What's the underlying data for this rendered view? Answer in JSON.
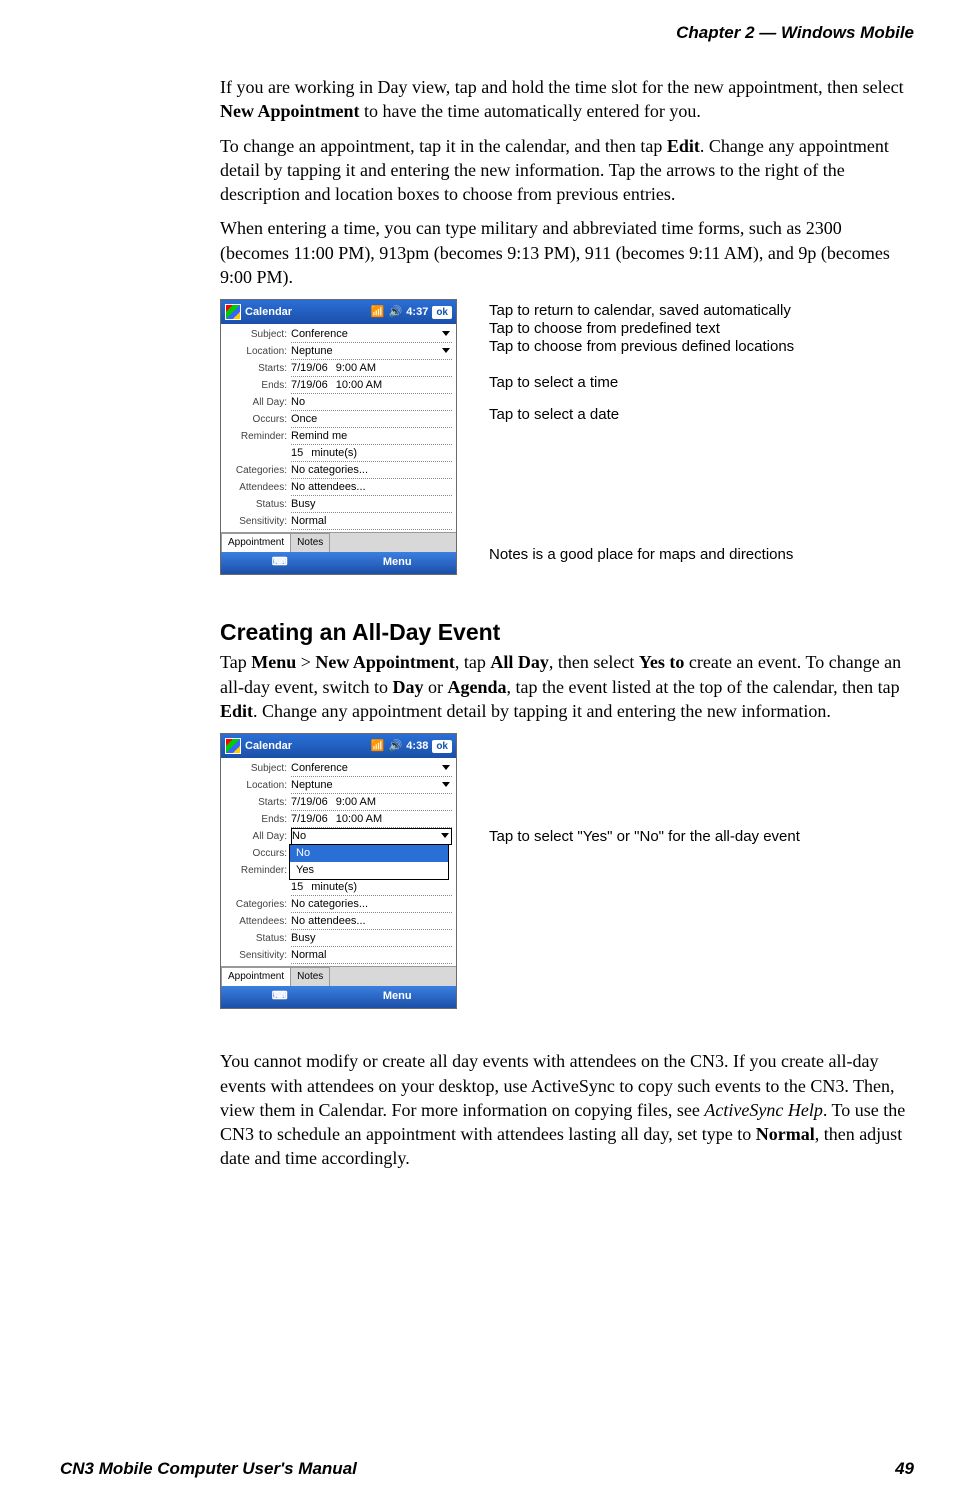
{
  "header": {
    "chapter": "Chapter 2 —  Windows Mobile"
  },
  "para1": {
    "a": "If you are working in Day view, tap and hold the time slot for the new appointment, then select ",
    "b": "New Appointment",
    "c": " to have the time automatically entered for you."
  },
  "para2": {
    "a": "To change an appointment, tap it in the calendar, and then tap ",
    "b": "Edit",
    "c": ". Change any appointment detail by tapping it and entering the new information. Tap the arrows to the right of the description and location boxes to choose from previous entries."
  },
  "para3": {
    "text": "When entering a time, you can type military and abbreviated time forms, such as 2300 (becomes 11:00 PM), 913pm (becomes 9:13 PM), 911 (becomes 9:11 AM), and 9p (becomes 9:00 PM)."
  },
  "fig1": {
    "callouts": {
      "c1": "Tap to return to calendar, saved automatically",
      "c2": "Tap to choose from predefined text",
      "c3": "Tap to choose from previous defined locations",
      "c4": "Tap to select a time",
      "c5": "Tap to select a date",
      "c6": "Notes is a good place for maps and directions"
    },
    "title": "Calendar",
    "time": "4:37",
    "ok": "ok",
    "labels": {
      "subject": "Subject:",
      "location": "Location:",
      "starts": "Starts:",
      "ends": "Ends:",
      "allday": "All Day:",
      "occurs": "Occurs:",
      "reminder": "Reminder:",
      "categories": "Categories:",
      "attendees": "Attendees:",
      "status": "Status:",
      "sensitivity": "Sensitivity:"
    },
    "values": {
      "subject": "Conference",
      "location": "Neptune",
      "start_date": "7/19/06",
      "start_time": "9:00 AM",
      "end_date": "7/19/06",
      "end_time": "10:00 AM",
      "allday": "No",
      "occurs": "Once",
      "reminder1": "Remind me",
      "reminder2a": "15",
      "reminder2b": "minute(s)",
      "categories": "No categories...",
      "attendees": "No attendees...",
      "status": "Busy",
      "sensitivity": "Normal"
    },
    "tabs": {
      "t1": "Appointment",
      "t2": "Notes"
    },
    "menu": "Menu"
  },
  "section2": {
    "heading": "Creating an All-Day Event",
    "p1": {
      "a": "Tap ",
      "b": "Menu",
      "c": " > ",
      "d": "New Appointment",
      "e": ", tap ",
      "f": "All Day",
      "g": ", then select ",
      "h": "Yes to",
      "i": " create an event. To change an all-day event, switch to ",
      "j": "Day",
      "k": " or ",
      "l": "Agenda",
      "m": ", tap the event listed at the top of the calendar, then tap ",
      "n": "Edit",
      "o": ". Change any appointment detail by tapping it and entering the new information."
    }
  },
  "fig2": {
    "callout": "Tap to select \"Yes\" or \"No\" for the all-day event",
    "title": "Calendar",
    "time": "4:38",
    "ok": "ok",
    "values": {
      "subject": "Conference",
      "location": "Neptune",
      "start_date": "7/19/06",
      "start_time": "9:00 AM",
      "end_date": "7/19/06",
      "end_time": "10:00 AM",
      "allday": "No",
      "opt1": "No",
      "opt2": "Yes",
      "reminder2a": "15",
      "reminder2b": "minute(s)",
      "categories": "No categories...",
      "attendees": "No attendees...",
      "status": "Busy",
      "sensitivity": "Normal"
    },
    "tabs": {
      "t1": "Appointment",
      "t2": "Notes"
    },
    "menu": "Menu"
  },
  "para_after": {
    "a": "You cannot modify or create all day events with attendees on the CN3. If you create all-day events with attendees on your desktop, use ActiveSync to copy such events to the CN3. Then, view them in Calendar. For more information on copying files, see ",
    "b": "ActiveSync Help",
    "c": ". To use the CN3 to schedule an appointment with attendees lasting all day, set type to ",
    "d": "Normal",
    "e": ", then adjust date and time accordingly."
  },
  "footer": {
    "manual": "CN3 Mobile Computer User's Manual",
    "page": "49"
  }
}
